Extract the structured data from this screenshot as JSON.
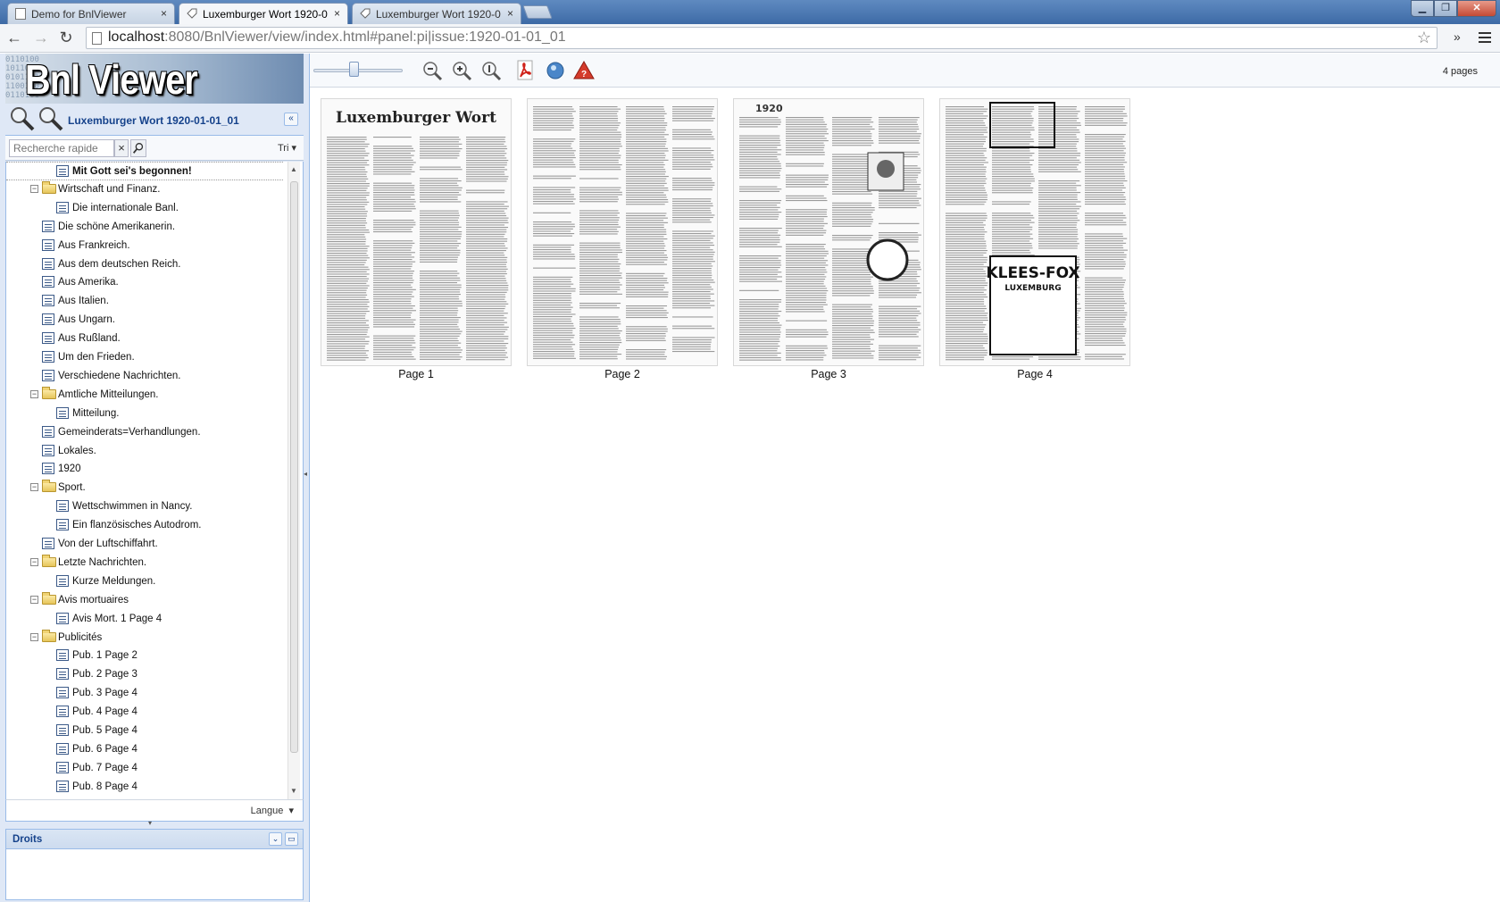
{
  "browser": {
    "tabs": [
      {
        "title": "Demo for BnlViewer",
        "close": "×"
      },
      {
        "title": "Luxemburger Wort 1920-0",
        "close": "×"
      },
      {
        "title": "Luxemburger Wort 1920-0",
        "close": "×"
      }
    ],
    "window_buttons": {
      "minimize": "▁",
      "maximize": "❐",
      "close": "✕"
    },
    "url_host": "localhost",
    "url_rest": ":8080/BnlViewer/view/index.html#panel:pi|issue:1920-01-01_01",
    "back": "←",
    "forward": "→",
    "reload": "↻",
    "star": "☆",
    "more": "»"
  },
  "app": {
    "logo": "Bnl Viewer",
    "logo_digits": "0110100\n1011011\n0101101\n1100100\n0110101",
    "issue_title": "Luxemburger Wort 1920-01-01_01",
    "collapse_glyph": "«",
    "search": {
      "placeholder": "Recherche rapide",
      "clear": "×",
      "sort_label": "Tri ▾"
    },
    "tree": [
      {
        "label": "Mit Gott sei's begonnen!",
        "level": 2,
        "type": "doc",
        "selected": true
      },
      {
        "label": "Wirtschaft und Finanz.",
        "level": 1,
        "type": "folder",
        "expanded": true
      },
      {
        "label": "Die internationale Banl.",
        "level": 2,
        "type": "doc"
      },
      {
        "label": "Die schöne Amerikanerin.",
        "level": 1,
        "type": "doc"
      },
      {
        "label": "Aus Frankreich.",
        "level": 1,
        "type": "doc"
      },
      {
        "label": "Aus dem deutschen Reich.",
        "level": 1,
        "type": "doc"
      },
      {
        "label": "Aus Amerika.",
        "level": 1,
        "type": "doc"
      },
      {
        "label": "Aus Italien.",
        "level": 1,
        "type": "doc"
      },
      {
        "label": "Aus Ungarn.",
        "level": 1,
        "type": "doc"
      },
      {
        "label": "Aus Rußland.",
        "level": 1,
        "type": "doc"
      },
      {
        "label": "Um den Frieden.",
        "level": 1,
        "type": "doc"
      },
      {
        "label": "Verschiedene Nachrichten.",
        "level": 1,
        "type": "doc"
      },
      {
        "label": "Amtliche Mitteilungen.",
        "level": 1,
        "type": "folder",
        "expanded": true
      },
      {
        "label": "Mitteilung.",
        "level": 2,
        "type": "doc"
      },
      {
        "label": "Gemeinderats=Verhandlungen.",
        "level": 1,
        "type": "doc"
      },
      {
        "label": "Lokales.",
        "level": 1,
        "type": "doc"
      },
      {
        "label": "1920",
        "level": 1,
        "type": "doc"
      },
      {
        "label": "Sport.",
        "level": 1,
        "type": "folder",
        "expanded": true
      },
      {
        "label": "Wettschwimmen in Nancy.",
        "level": 2,
        "type": "doc"
      },
      {
        "label": "Ein flanzösisches Autodrom.",
        "level": 2,
        "type": "doc"
      },
      {
        "label": "Von der Luftschiffahrt.",
        "level": 1,
        "type": "doc"
      },
      {
        "label": "Letzte Nachrichten.",
        "level": 1,
        "type": "folder",
        "expanded": true
      },
      {
        "label": "Kurze Meldungen.",
        "level": 2,
        "type": "doc"
      },
      {
        "label": "Avis mortuaires",
        "level": 1,
        "type": "folder",
        "expanded": true
      },
      {
        "label": "Avis Mort.  1 Page 4",
        "level": 2,
        "type": "doc"
      },
      {
        "label": "Publicités",
        "level": 1,
        "type": "folder",
        "expanded": true
      },
      {
        "label": "Pub.  1 Page 2",
        "level": 2,
        "type": "doc"
      },
      {
        "label": "Pub.  2 Page 3",
        "level": 2,
        "type": "doc"
      },
      {
        "label": "Pub.  3 Page 4",
        "level": 2,
        "type": "doc"
      },
      {
        "label": "Pub.  4 Page 4",
        "level": 2,
        "type": "doc"
      },
      {
        "label": "Pub.  5 Page 4",
        "level": 2,
        "type": "doc"
      },
      {
        "label": "Pub.  6 Page 4",
        "level": 2,
        "type": "doc"
      },
      {
        "label": "Pub.  7 Page 4",
        "level": 2,
        "type": "doc"
      },
      {
        "label": "Pub.  8 Page 4",
        "level": 2,
        "type": "doc"
      }
    ],
    "language_label": "Langue",
    "rights_title": "Droits",
    "viewer": {
      "pages_count": "4 pages",
      "zoom_slider_fraction": 0.45,
      "pages": [
        {
          "label": "Page 1",
          "masthead": "Luxemburger Wort"
        },
        {
          "label": "Page 2",
          "masthead": ""
        },
        {
          "label": "Page 3",
          "masthead": "1920"
        },
        {
          "label": "Page 4",
          "masthead": "KLEES-FOX",
          "sub": "LUXEMBURG"
        }
      ]
    }
  },
  "colors": {
    "panel_bg": "#dfe8f6",
    "panel_border": "#99bbe8",
    "title_blue": "#15428b"
  }
}
